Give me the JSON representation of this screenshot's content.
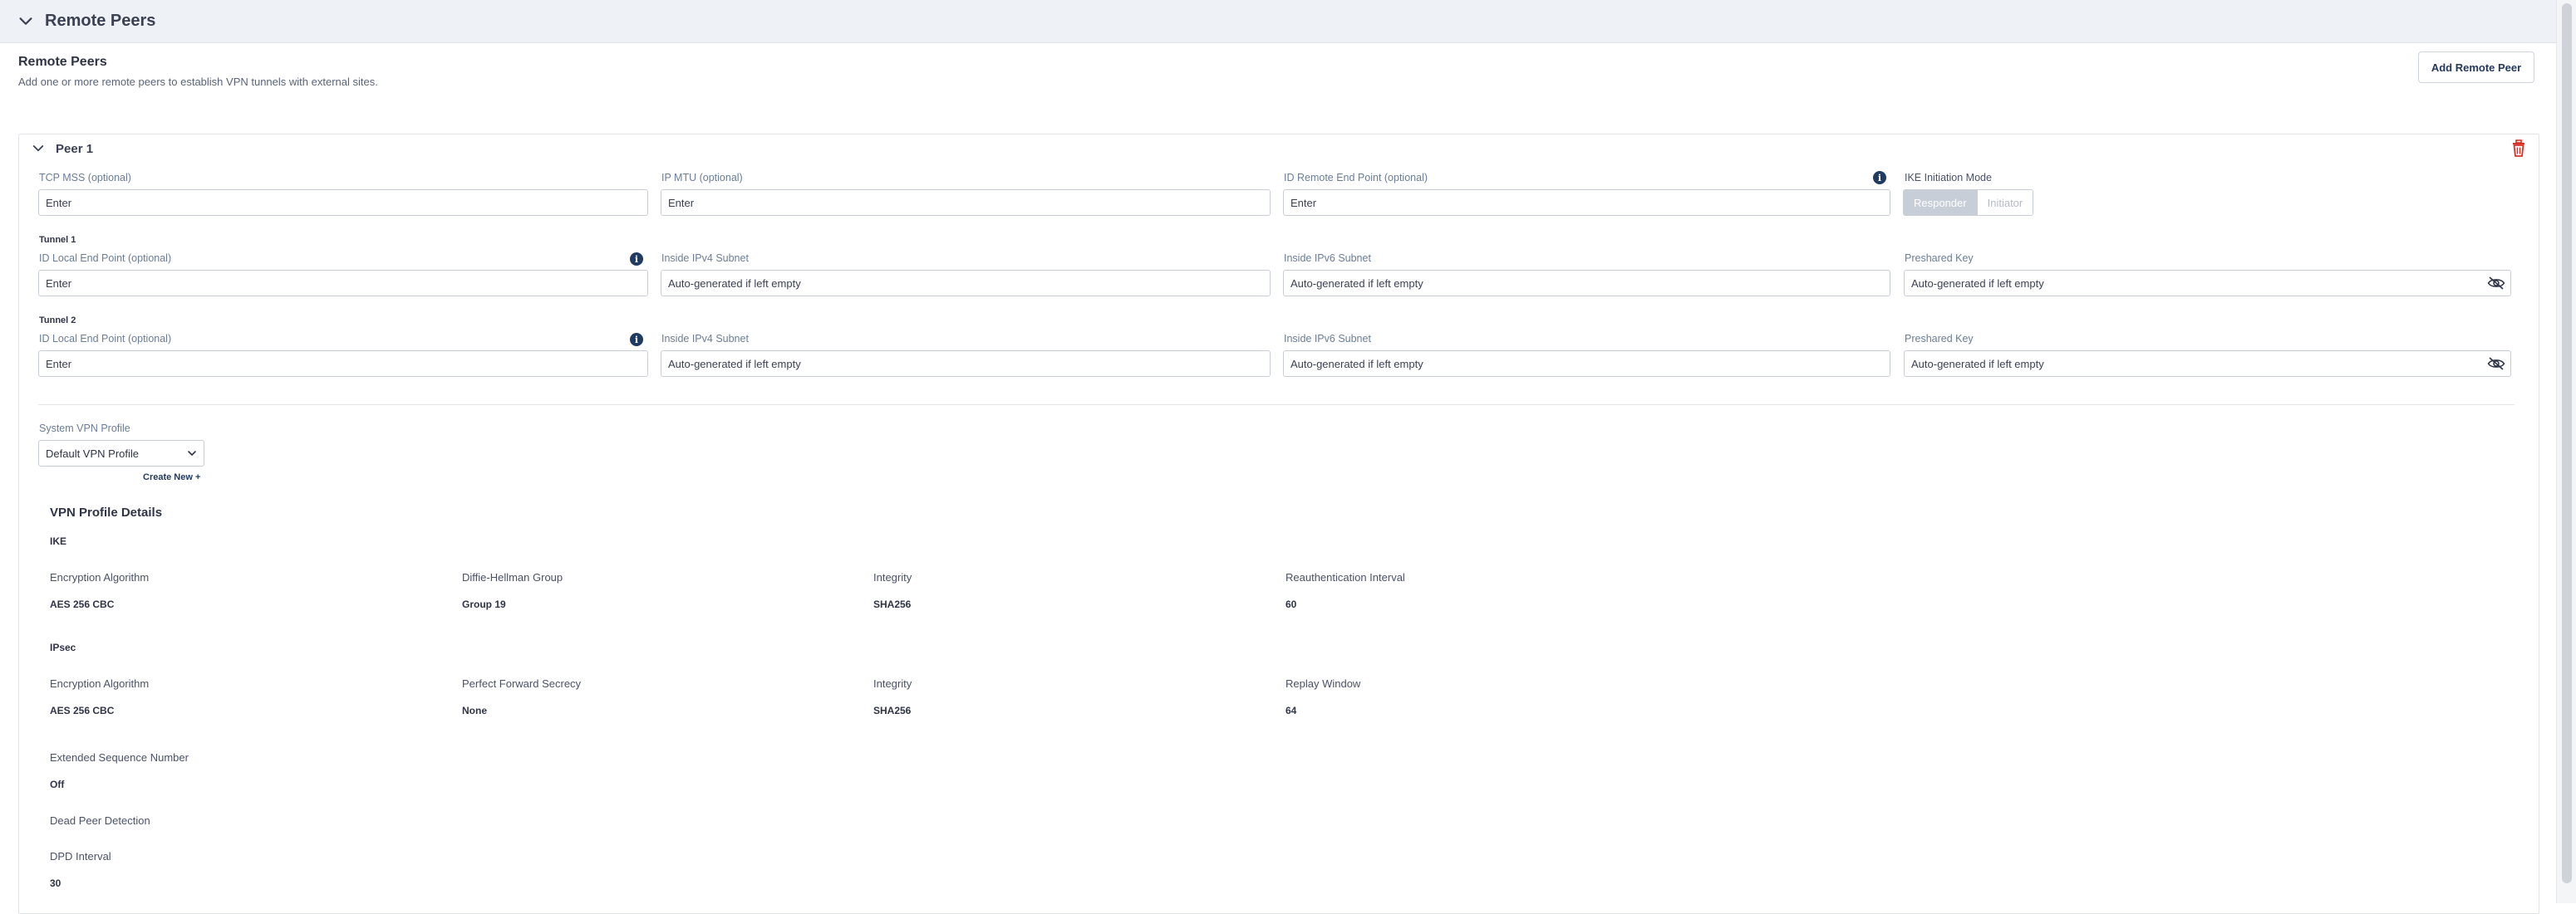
{
  "section": {
    "title": "Remote Peers"
  },
  "intro": {
    "title": "Remote Peers",
    "description": "Add one or more remote peers to establish VPN tunnels with external sites.",
    "add_button": "Add Remote Peer"
  },
  "peer": {
    "title": "Peer 1",
    "tcp_mss": {
      "label": "TCP MSS (optional)",
      "placeholder": "Enter"
    },
    "ip_mtu": {
      "label": "IP MTU (optional)",
      "placeholder": "Enter"
    },
    "id_remote": {
      "label": "ID Remote End Point (optional)",
      "placeholder": "Enter"
    },
    "ike_mode": {
      "label": "IKE Initiation Mode",
      "options": [
        "Responder",
        "Initiator"
      ],
      "selected": "Responder"
    },
    "tunnels": [
      {
        "title": "Tunnel 1",
        "id_local": {
          "label": "ID Local End Point (optional)",
          "placeholder": "Enter"
        },
        "ipv4": {
          "label": "Inside IPv4 Subnet",
          "placeholder": "Auto-generated if left empty"
        },
        "ipv6": {
          "label": "Inside IPv6 Subnet",
          "placeholder": "Auto-generated if left empty"
        },
        "psk": {
          "label": "Preshared Key",
          "placeholder": "Auto-generated if left empty"
        }
      },
      {
        "title": "Tunnel 2",
        "id_local": {
          "label": "ID Local End Point (optional)",
          "placeholder": "Enter"
        },
        "ipv4": {
          "label": "Inside IPv4 Subnet",
          "placeholder": "Auto-generated if left empty"
        },
        "ipv6": {
          "label": "Inside IPv6 Subnet",
          "placeholder": "Auto-generated if left empty"
        },
        "psk": {
          "label": "Preshared Key",
          "placeholder": "Auto-generated if left empty"
        }
      }
    ],
    "vpn_profile": {
      "label": "System VPN Profile",
      "value": "Default VPN Profile",
      "create_new": "Create New +"
    },
    "details": {
      "title": "VPN Profile Details",
      "ike": {
        "title": "IKE",
        "items": [
          {
            "label": "Encryption Algorithm",
            "value": "AES 256 CBC"
          },
          {
            "label": "Diffie-Hellman Group",
            "value": "Group 19"
          },
          {
            "label": "Integrity",
            "value": "SHA256"
          },
          {
            "label": "Reauthentication Interval",
            "value": "60"
          }
        ]
      },
      "ipsec": {
        "title": "IPsec",
        "items": [
          {
            "label": "Encryption Algorithm",
            "value": "AES 256 CBC"
          },
          {
            "label": "Perfect Forward Secrecy",
            "value": "None"
          },
          {
            "label": "Integrity",
            "value": "SHA256"
          },
          {
            "label": "Replay Window",
            "value": "64"
          }
        ]
      },
      "esn": {
        "label": "Extended Sequence Number",
        "value": "Off"
      },
      "dpd": {
        "label": "Dead Peer Detection"
      },
      "dpd_interval": {
        "label": "DPD Interval",
        "value": "30"
      }
    }
  },
  "colors": {
    "accent": "#23395b",
    "danger": "#d93025",
    "info": "#1f3b63"
  },
  "icons": {
    "collapse": "chevron-down-icon",
    "delete": "trash-icon",
    "info": "info-icon",
    "hide": "eye-off-icon",
    "dropdown": "chevron-down-icon"
  }
}
